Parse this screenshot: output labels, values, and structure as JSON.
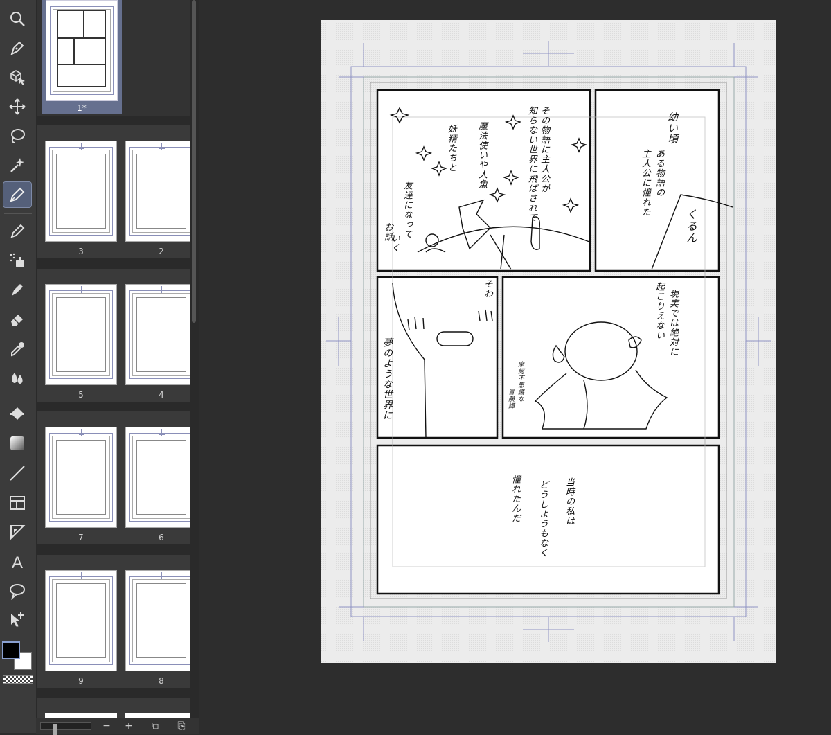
{
  "toolbar": {
    "tools": [
      {
        "name": "zoom-tool",
        "icon": "magnifier-icon"
      },
      {
        "name": "operation-tool",
        "icon": "pen-nib-icon"
      },
      {
        "name": "object-tool",
        "icon": "cube-cursor-icon"
      },
      {
        "name": "move-layer-tool",
        "icon": "move-arrows-icon"
      },
      {
        "name": "lasso-selection-tool",
        "icon": "lasso-icon"
      },
      {
        "name": "auto-select-tool",
        "icon": "magic-wand-icon"
      },
      {
        "name": "pen-tool",
        "icon": "pen-icon",
        "active": true
      },
      {
        "name": "pencil-tool",
        "icon": "pencil-icon"
      },
      {
        "name": "airbrush-tool",
        "icon": "airbrush-icon"
      },
      {
        "name": "decoration-tool",
        "icon": "marker-icon"
      },
      {
        "name": "eraser-tool",
        "icon": "eraser-icon"
      },
      {
        "name": "eyedropper-tool",
        "icon": "eyedropper-icon"
      },
      {
        "name": "blend-tool",
        "icon": "droplets-icon"
      },
      {
        "name": "fill-tool",
        "icon": "paint-bucket-icon"
      },
      {
        "name": "gradient-tool",
        "icon": "gradient-icon"
      },
      {
        "name": "figure-tool",
        "icon": "line-icon"
      },
      {
        "name": "frame-border-tool",
        "icon": "frame-icon"
      },
      {
        "name": "ruler-tool",
        "icon": "ruler-triangle-icon"
      },
      {
        "name": "text-tool",
        "icon": "text-icon"
      },
      {
        "name": "balloon-tool",
        "icon": "speech-balloon-icon"
      },
      {
        "name": "correct-line-tool",
        "icon": "vector-arrow-icon"
      }
    ],
    "main_color": "#000000",
    "sub_color": "#ffffff",
    "accent_color": "#55607a"
  },
  "pages_panel": {
    "pages": [
      {
        "label": "1*",
        "selected": true
      },
      {
        "label": "3"
      },
      {
        "label": "2"
      },
      {
        "label": "5"
      },
      {
        "label": "4"
      },
      {
        "label": "7"
      },
      {
        "label": "6"
      },
      {
        "label": "9"
      },
      {
        "label": "8"
      }
    ],
    "bottom_buttons": [
      "−",
      "+",
      "⧉",
      "⎘"
    ]
  },
  "canvas": {
    "panel1_text": [
      "その物語に主人公が",
      "知らない世界に飛ばされて",
      "魔法使いや人魚",
      "妖精たちと",
      "友達になって",
      "いく",
      "お話"
    ],
    "panel2_text": [
      "幼い頃",
      "ある物語の",
      "主人公に憧れた"
    ],
    "panel2_sfx": "くるん",
    "panel3_text": [
      "夢のような世界に"
    ],
    "panel3_sfx": "そわ",
    "panel4_text": [
      "現実では絶対に",
      "起こりえない"
    ],
    "panel4_small": [
      "摩訶不思議な",
      "冒険譚"
    ],
    "panel5_text": [
      "当時の私は",
      "どうしようもなく",
      "憧れたんだ"
    ]
  }
}
